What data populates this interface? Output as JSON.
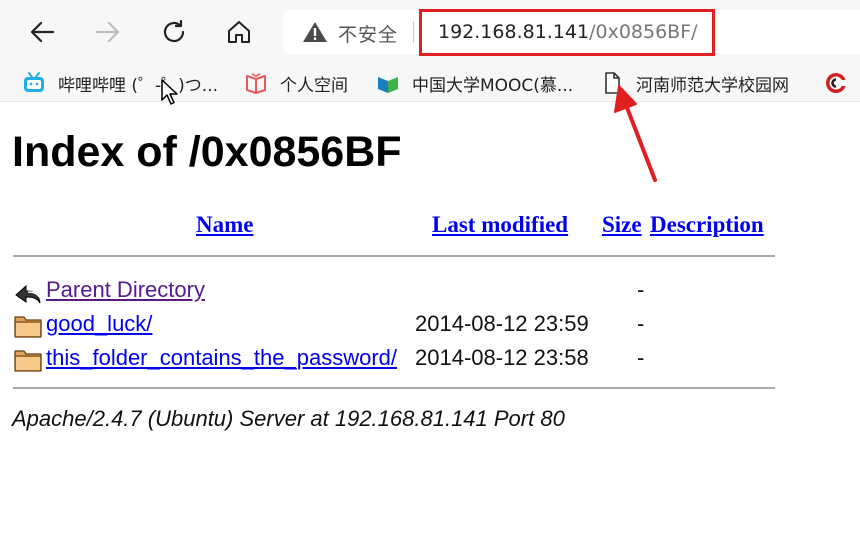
{
  "browser": {
    "security_label": "不安全",
    "url_host": "192.168.81.141",
    "url_path": "/0x0856BF/",
    "bookmarks": [
      {
        "label": "哔哩哔哩 (゜-゜)つ...",
        "icon": "bilibili-icon"
      },
      {
        "label": "个人空间",
        "icon": "book-icon"
      },
      {
        "label": "中国大学MOOC(慕...",
        "icon": "mooc-icon"
      },
      {
        "label": "河南师范大学校园网",
        "icon": "page-icon"
      }
    ],
    "colors": {
      "annotation": "#e02020",
      "toolbar_bg": "#f7f7f7"
    }
  },
  "page": {
    "title": "Index of /0x0856BF",
    "columns": {
      "name": "Name",
      "last_modified": "Last modified",
      "size": "Size",
      "description": "Description"
    },
    "rows": [
      {
        "name": "Parent Directory",
        "date": "",
        "size": "-",
        "icon": "back-arrow-icon"
      },
      {
        "name": "good_luck/",
        "date": "2014-08-12 23:59",
        "size": "-",
        "icon": "folder-icon"
      },
      {
        "name": "this_folder_contains_the_password/",
        "date": "2014-08-12 23:58",
        "size": "-",
        "icon": "folder-icon"
      }
    ],
    "footer": "Apache/2.4.7 (Ubuntu) Server at 192.168.81.141 Port 80",
    "colors": {
      "link": "#0000ee",
      "visited": "#551a8b"
    }
  }
}
